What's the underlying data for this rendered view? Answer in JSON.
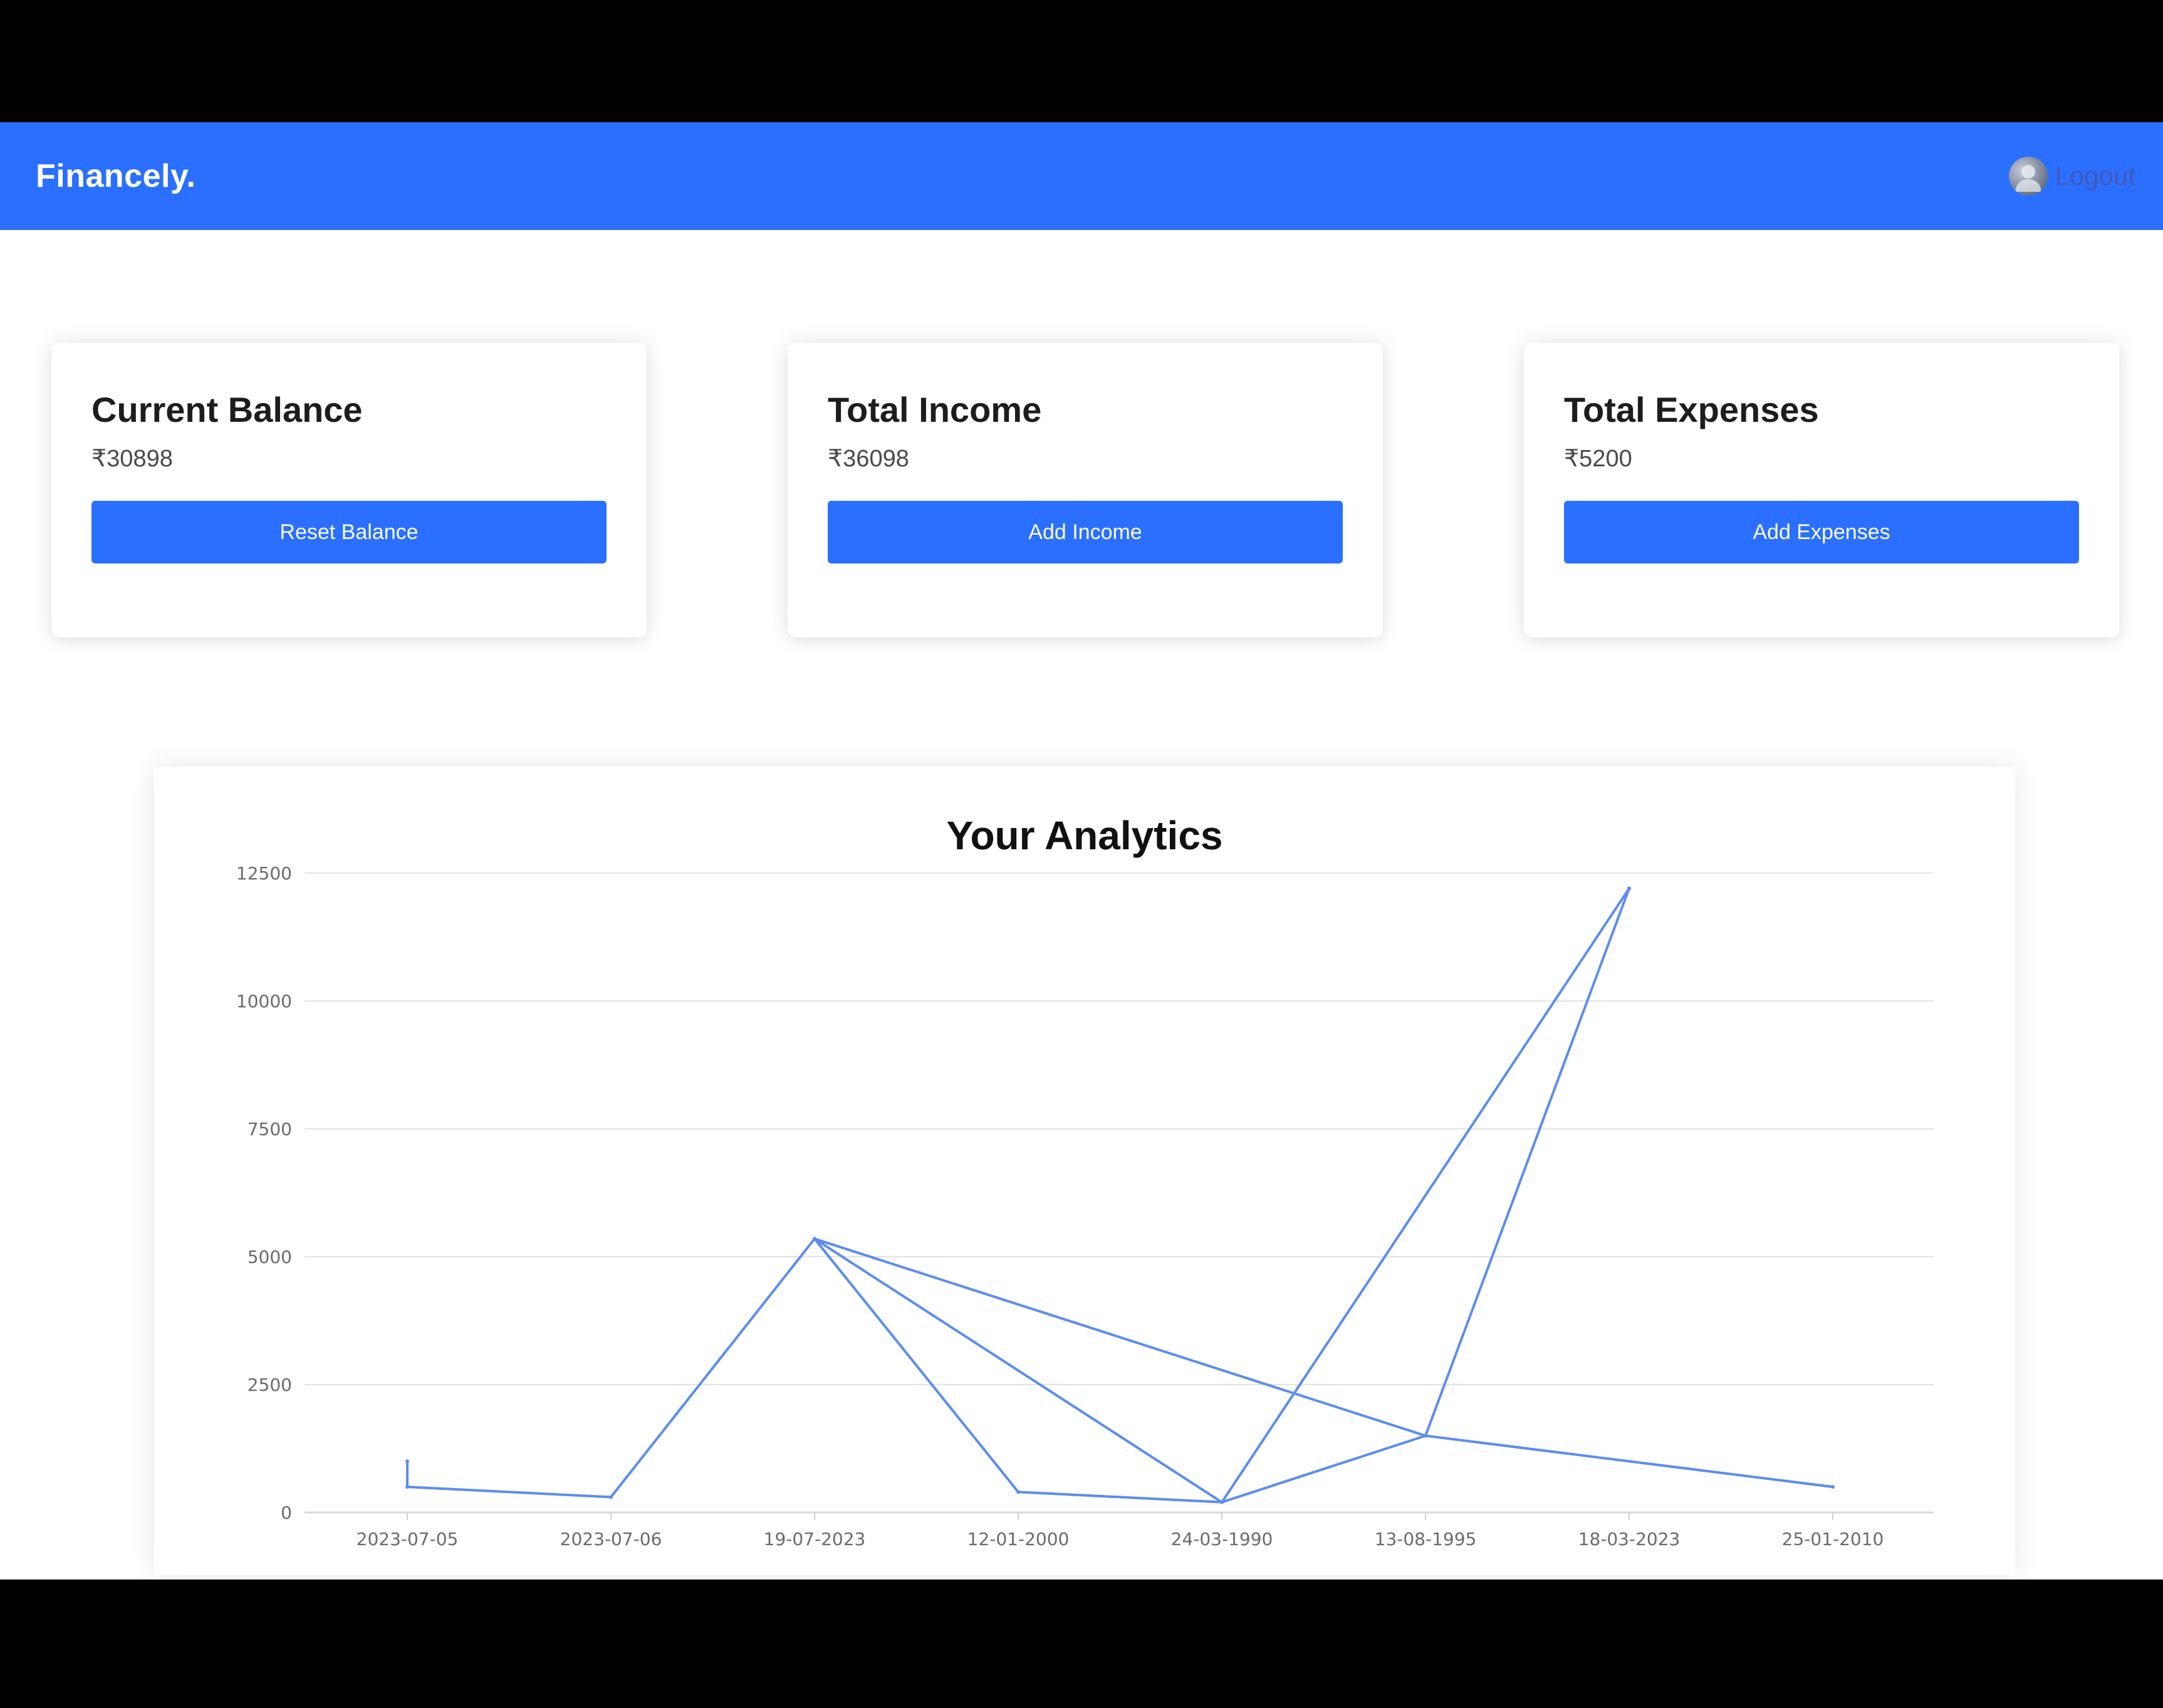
{
  "app": {
    "brand": "Financely.",
    "logout_label": "Logout",
    "accent_color": "#2a6fff"
  },
  "cards": [
    {
      "title": "Current Balance",
      "value": "₹30898",
      "button_label": "Reset Balance"
    },
    {
      "title": "Total Income",
      "value": "₹36098",
      "button_label": "Add Income"
    },
    {
      "title": "Total Expenses",
      "value": "₹5200",
      "button_label": "Add Expenses"
    }
  ],
  "analytics": {
    "title": "Your Analytics"
  },
  "chart_data": {
    "type": "line",
    "title": "Your Analytics",
    "xlabel": "",
    "ylabel": "",
    "categories": [
      "2023-07-05",
      "2023-07-06",
      "19-07-2023",
      "12-01-2000",
      "24-03-1990",
      "13-08-1995",
      "18-03-2023",
      "25-01-2010"
    ],
    "yticks": [
      0,
      2500,
      5000,
      7500,
      10000,
      12500
    ],
    "ylim": [
      0,
      12500
    ],
    "grid": true,
    "line_color": "#5b8def",
    "x": [
      0,
      0,
      1,
      2,
      3,
      4,
      2,
      4,
      5,
      6,
      4,
      6,
      5,
      2,
      5,
      7
    ],
    "y": [
      1000,
      500,
      300,
      5350,
      400,
      200,
      5350,
      200,
      1500,
      12200,
      200,
      12200,
      1500,
      5350,
      1500,
      500
    ]
  }
}
